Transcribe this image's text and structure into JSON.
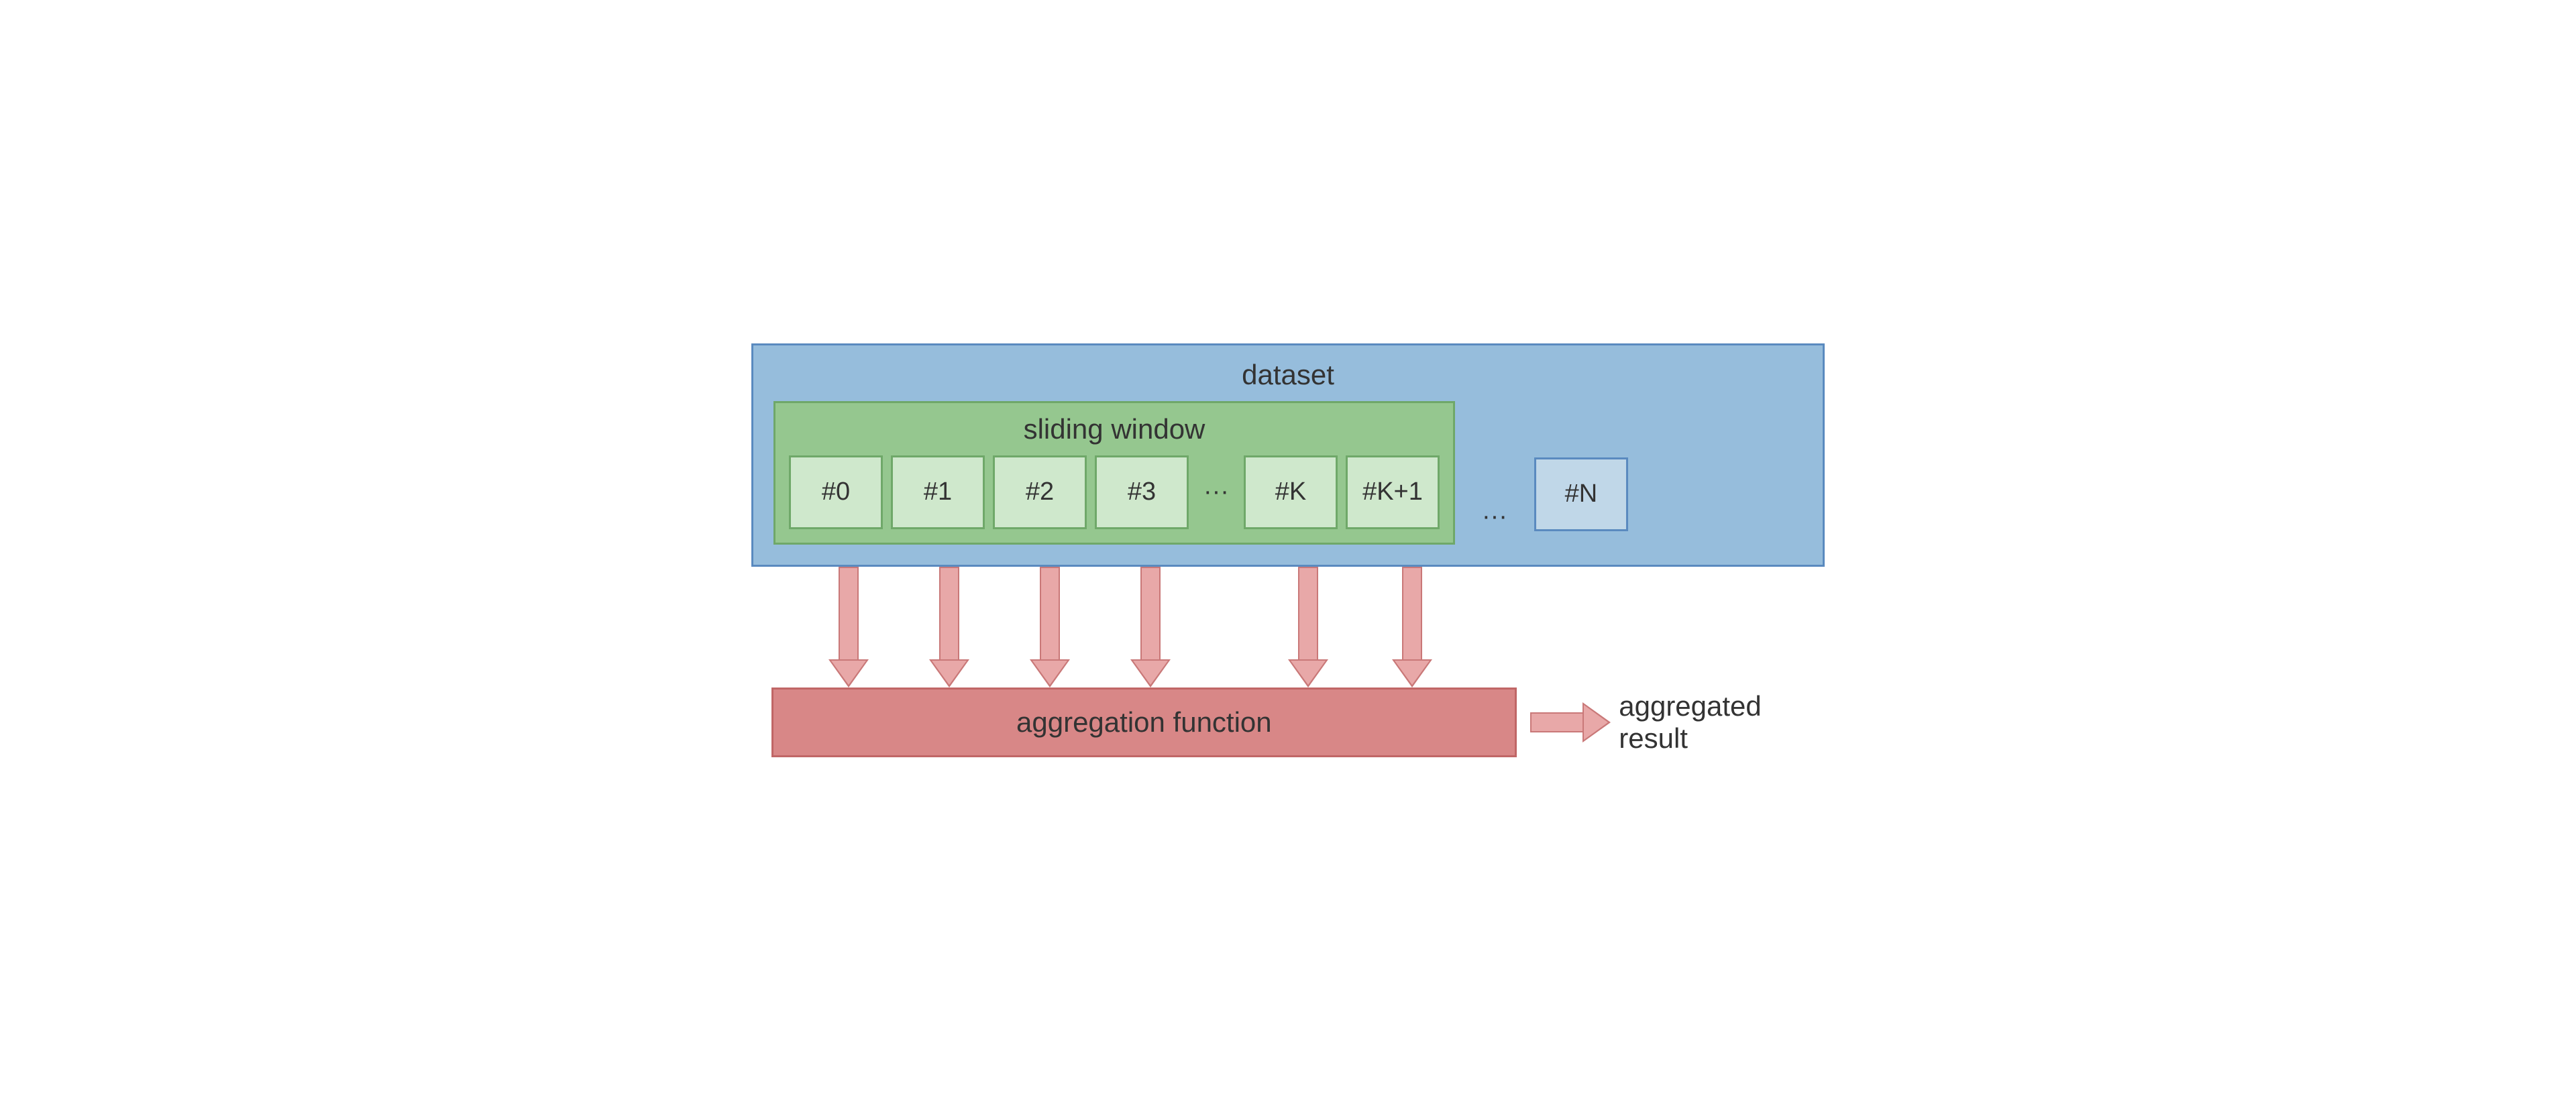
{
  "dataset": {
    "label": "dataset",
    "last_item": "#N"
  },
  "sliding_window": {
    "label": "sliding window",
    "items": [
      "#0",
      "#1",
      "#2",
      "#3"
    ],
    "tail_items": [
      "#K",
      "#K+1"
    ]
  },
  "ellipsis": "···",
  "aggregation": {
    "label": "aggregation function",
    "result_label": "aggregated result"
  }
}
